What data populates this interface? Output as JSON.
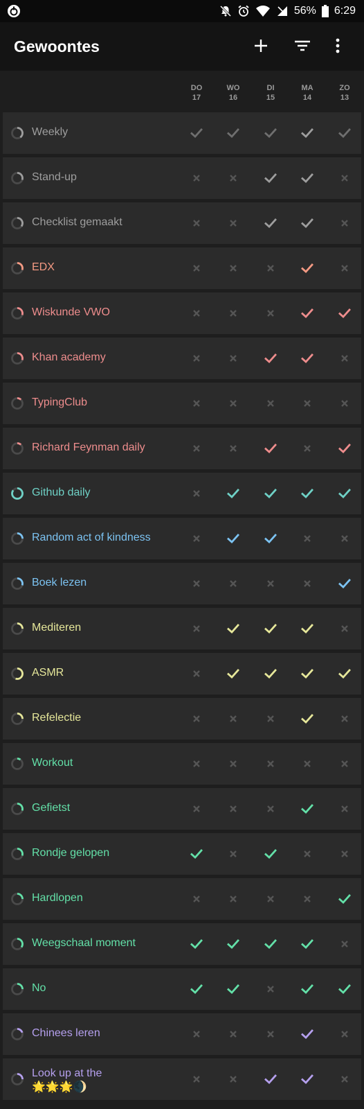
{
  "status_bar": {
    "battery_percent": "56%",
    "time": "6:29"
  },
  "app_bar": {
    "title": "Gewoontes",
    "actions": [
      "add-icon",
      "filter-icon",
      "more-vert-icon"
    ]
  },
  "days": [
    {
      "dow": "DO",
      "date": "17"
    },
    {
      "dow": "WO",
      "date": "16"
    },
    {
      "dow": "DI",
      "date": "15"
    },
    {
      "dow": "MA",
      "date": "14"
    },
    {
      "dow": "ZO",
      "date": "13"
    }
  ],
  "colors": {
    "gray": "#9e9e9e",
    "orange": "#f49a83",
    "red": "#ee8d8d",
    "teal": "#6fd1c6",
    "blue": "#7cc3f2",
    "yellow": "#e6e79a",
    "green": "#63e0a8",
    "purple": "#b5a0ee",
    "off": "#555555"
  },
  "habits": [
    {
      "name": "Weekly",
      "color": "gray",
      "progress": 0.4,
      "checks": [
        1,
        1,
        1,
        1,
        1
      ],
      "active": [
        0,
        0,
        0,
        1,
        0
      ]
    },
    {
      "name": "Stand-up",
      "color": "gray",
      "progress": 0.3,
      "checks": [
        0,
        0,
        1,
        1,
        0
      ],
      "active": [
        0,
        0,
        1,
        1,
        0
      ]
    },
    {
      "name": "Checklist gemaakt",
      "color": "gray",
      "progress": 0.35,
      "checks": [
        0,
        0,
        1,
        1,
        0
      ],
      "active": [
        0,
        0,
        1,
        1,
        0
      ]
    },
    {
      "name": "EDX",
      "color": "orange",
      "progress": 0.3,
      "checks": [
        0,
        0,
        0,
        1,
        0
      ],
      "active": [
        0,
        0,
        0,
        1,
        0
      ]
    },
    {
      "name": "Wiskunde VWO",
      "color": "red",
      "progress": 0.3,
      "checks": [
        0,
        0,
        0,
        1,
        1
      ],
      "active": [
        0,
        0,
        0,
        1,
        1
      ]
    },
    {
      "name": "Khan academy",
      "color": "red",
      "progress": 0.3,
      "checks": [
        0,
        0,
        1,
        1,
        0
      ],
      "active": [
        0,
        0,
        1,
        1,
        0
      ]
    },
    {
      "name": "TypingClub",
      "color": "red",
      "progress": 0.12,
      "checks": [
        0,
        0,
        0,
        0,
        0
      ],
      "active": [
        0,
        0,
        0,
        0,
        0
      ]
    },
    {
      "name": "Richard Feynman daily",
      "color": "red",
      "progress": 0.12,
      "checks": [
        0,
        0,
        1,
        0,
        1
      ],
      "active": [
        0,
        0,
        1,
        0,
        1
      ]
    },
    {
      "name": "Github daily",
      "color": "teal",
      "progress": 0.85,
      "checks": [
        0,
        1,
        1,
        1,
        1
      ],
      "active": [
        0,
        1,
        1,
        1,
        1
      ]
    },
    {
      "name": "Random act of kindness",
      "color": "blue",
      "progress": 0.25,
      "checks": [
        0,
        1,
        1,
        0,
        0
      ],
      "active": [
        0,
        1,
        1,
        0,
        0
      ]
    },
    {
      "name": "Boek lezen",
      "color": "blue",
      "progress": 0.3,
      "checks": [
        0,
        0,
        0,
        0,
        1
      ],
      "active": [
        0,
        0,
        0,
        0,
        1
      ]
    },
    {
      "name": "Mediteren",
      "color": "yellow",
      "progress": 0.25,
      "checks": [
        0,
        1,
        1,
        1,
        0
      ],
      "active": [
        0,
        1,
        1,
        1,
        0
      ]
    },
    {
      "name": "ASMR",
      "color": "yellow",
      "progress": 0.55,
      "checks": [
        0,
        1,
        1,
        1,
        1
      ],
      "active": [
        0,
        1,
        1,
        1,
        1
      ]
    },
    {
      "name": "Refelectie",
      "color": "yellow",
      "progress": 0.25,
      "checks": [
        0,
        0,
        0,
        1,
        0
      ],
      "active": [
        0,
        0,
        0,
        1,
        0
      ]
    },
    {
      "name": "Workout",
      "color": "green",
      "progress": 0.1,
      "checks": [
        0,
        0,
        0,
        0,
        0
      ],
      "active": [
        0,
        0,
        0,
        0,
        0
      ]
    },
    {
      "name": "Gefietst",
      "color": "green",
      "progress": 0.3,
      "checks": [
        0,
        0,
        0,
        1,
        0
      ],
      "active": [
        0,
        0,
        0,
        1,
        0
      ]
    },
    {
      "name": "Rondje gelopen",
      "color": "green",
      "progress": 0.3,
      "checks": [
        1,
        0,
        1,
        0,
        0
      ],
      "active": [
        1,
        0,
        1,
        0,
        0
      ]
    },
    {
      "name": "Hardlopen",
      "color": "green",
      "progress": 0.25,
      "checks": [
        0,
        0,
        0,
        0,
        1
      ],
      "active": [
        0,
        0,
        0,
        0,
        1
      ]
    },
    {
      "name": "Weegschaal moment",
      "color": "green",
      "progress": 0.35,
      "checks": [
        1,
        1,
        1,
        1,
        0
      ],
      "active": [
        1,
        1,
        1,
        1,
        0
      ]
    },
    {
      "name": "No",
      "color": "green",
      "progress": 0.25,
      "checks": [
        1,
        1,
        0,
        1,
        1
      ],
      "active": [
        1,
        1,
        0,
        1,
        1
      ]
    },
    {
      "name": "Chinees leren",
      "color": "purple",
      "progress": 0.2,
      "checks": [
        0,
        0,
        0,
        1,
        0
      ],
      "active": [
        0,
        0,
        0,
        1,
        0
      ]
    },
    {
      "name": "Look up at the",
      "name_line2": "🌟🌟🌟🌒",
      "color": "purple",
      "progress": 0.25,
      "checks": [
        0,
        0,
        1,
        1,
        0
      ],
      "active": [
        0,
        0,
        1,
        1,
        0
      ]
    }
  ]
}
